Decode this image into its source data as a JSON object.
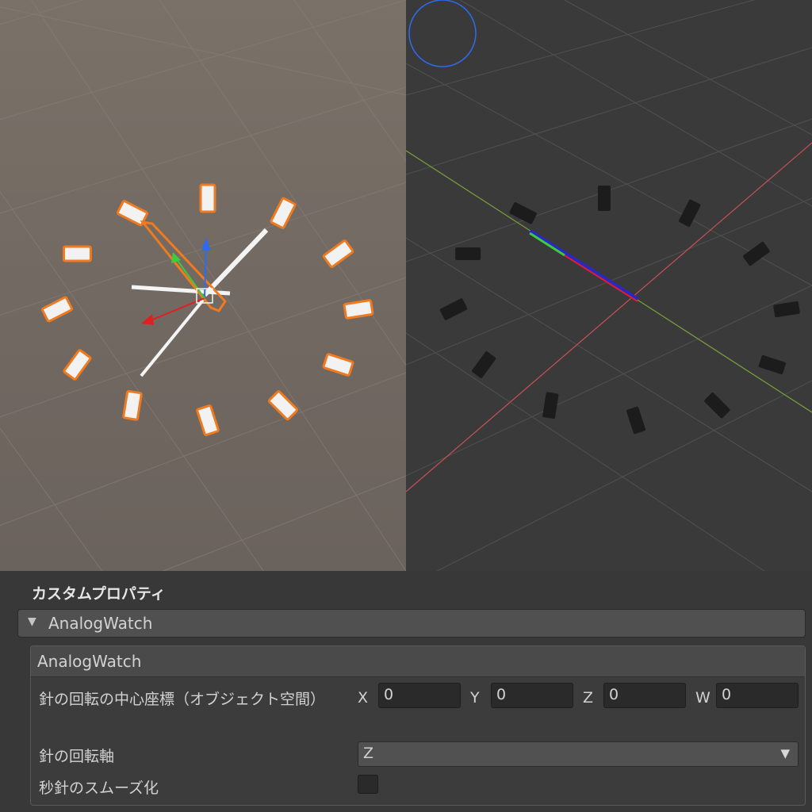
{
  "inspector": {
    "section_title": "カスタムプロパティ",
    "foldout_label": "AnalogWatch",
    "panel_title": "AnalogWatch",
    "properties": {
      "center": {
        "label": "針の回転の中心座標（オブジェクト空間）",
        "x_label": "X",
        "x_value": "0",
        "y_label": "Y",
        "y_value": "0",
        "z_label": "Z",
        "z_value": "0",
        "w_label": "W",
        "w_value": "0"
      },
      "axis": {
        "label": "針の回転軸",
        "value": "Z"
      },
      "smooth": {
        "label": "秒針のスムーズ化",
        "checked": false
      }
    }
  },
  "views": {
    "scene": {
      "background": "#6b625c",
      "selection_color": "#f07a1f",
      "marker_color": "#f2f2f2"
    },
    "game": {
      "background": "#393939",
      "marker_color": "#1c1c1c"
    }
  },
  "colors": {
    "gizmo_x": "#e02020",
    "gizmo_y": "#3ccc3c",
    "gizmo_z": "#2e6bf0",
    "axis_line_red": "#c8505a",
    "axis_line_green": "#7aa03a"
  },
  "icons": [
    "dropdown-caret-icon",
    "foldout-arrow-icon",
    "scene-gizmo-icon"
  ]
}
